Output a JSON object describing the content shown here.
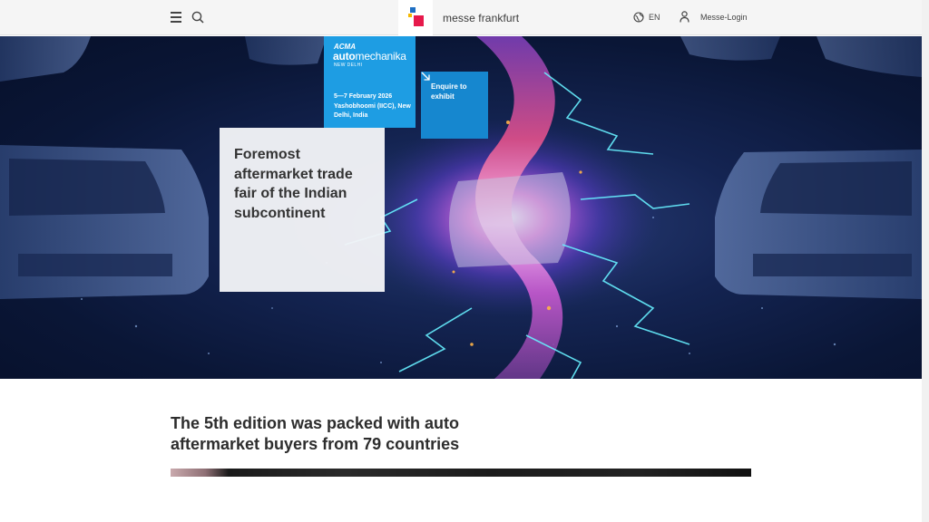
{
  "header": {
    "brand": "messe frankfurt",
    "language": "EN",
    "login": "Messe-Login",
    "logo_colors": [
      "#e6194b",
      "#1e6fc3",
      "#f6b800"
    ]
  },
  "event": {
    "org": "ACMA",
    "name_bold": "auto",
    "name_rest": "mechanika",
    "city": "NEW DELHI",
    "dates": "5—7 February 2026",
    "venue": "Yashobhoomi (IICC), New Delhi, India",
    "color": "#1e9de3"
  },
  "cta": {
    "label": "Enquire to exhibit",
    "color": "#1687cf"
  },
  "hero": {
    "headline": "Foremost aftermarket trade fair of the Indian subcontinent"
  },
  "section": {
    "title": "The 5th edition was packed with auto aftermarket buyers from 79 countries"
  }
}
